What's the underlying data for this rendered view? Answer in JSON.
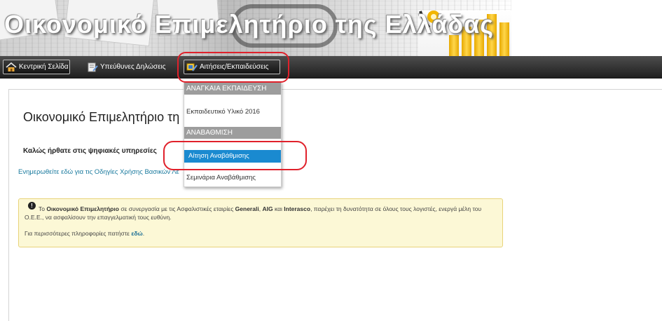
{
  "banner": {
    "title": "Οικονομικό Επιμελητήριο της Ελλάδας"
  },
  "nav": {
    "items": [
      {
        "label": "Κεντρική Σελίδα",
        "icon": "home-icon"
      },
      {
        "label": "Υπεύθυνες Δηλώσεις",
        "icon": "document-icon"
      },
      {
        "label": "Αιτήσεις/Εκπαιδεύσεις",
        "icon": "applications-icon"
      }
    ]
  },
  "dropdown": {
    "section1_header": "ΑΝΑΓΚΑΙΑ ΕΚΠΑΙΔΕΥΣΗ",
    "item_material": "Εκπαιδευτικό Υλικό 2016",
    "section2_header": "ΑΝΑΒΑΘΜΙΣΗ",
    "item_upgrade_request": "Αίτηση Αναβάθμισης",
    "item_upgrade_seminars": "Σεμινάρια Αναβάθμισης"
  },
  "main": {
    "title": "Οικονομικό Επιμελητήριο τη",
    "welcome": "Καλώς ήρθατε στις ψηφιακές υπηρεσίες",
    "info_link": "Ενημερωθείτε εδώ για τις Οδηγίες Χρήσης Βασικών Λε"
  },
  "alert": {
    "text_prefix": "Το",
    "org": "Οικονομικό Επιμελητήριο",
    "text_mid1": "σε συνεργασία με τις Ασφαλιστικές εταιρίες",
    "company1": "Generali",
    "company2": "AIG",
    "and": "και",
    "company3": "Interasco",
    "text_mid2": ", παρέχει τη δυνατότητα σε όλους τους λογιστές, ενεργά μέλη του Ο.Ε.Ε., να ασφαλίσουν την επαγγελματική τους ευθύνη.",
    "more_text": "Για περισσότερες πληροφορίες πατήστε",
    "more_link": "εδώ",
    "period": "."
  },
  "colors": {
    "navbar": "#2b2b2b",
    "highlight": "#e0212b",
    "active_item": "#1a8ad0",
    "link": "#1a7a9e",
    "alert_bg": "#fcf8d6"
  }
}
